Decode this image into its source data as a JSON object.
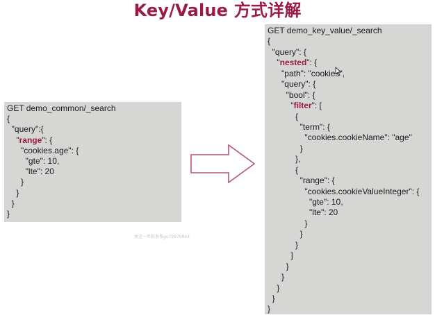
{
  "title": "Key/Value 方式详解",
  "watermark": "关注一年前发布go79979844",
  "left_code": [
    [
      "GET demo_common/_search"
    ],
    [
      "{"
    ],
    [
      "  \"query\":{"
    ],
    [
      "    \"",
      {
        "hl": "range"
      },
      "\": {"
    ],
    [
      "      \"cookies.age\": {"
    ],
    [
      "        \"gte\": 10,"
    ],
    [
      "        \"lte\": 20"
    ],
    [
      "      }"
    ],
    [
      "    }"
    ],
    [
      "  }"
    ],
    [
      "}"
    ]
  ],
  "right_code": [
    [
      "GET demo_key_value/_search"
    ],
    [
      "{"
    ],
    [
      "  \"query\": {"
    ],
    [
      "    \"",
      {
        "hl": "nested"
      },
      "\": {"
    ],
    [
      "      \"path\": \"cookies\","
    ],
    [
      "      \"query\": {"
    ],
    [
      "        \"bool\": {"
    ],
    [
      "          \"",
      {
        "hl": "filter"
      },
      "\": ["
    ],
    [
      "            {"
    ],
    [
      "              \"term\": {"
    ],
    [
      "                \"cookies.cookieName\": \"age\""
    ],
    [
      "              }"
    ],
    [
      "            },"
    ],
    [
      "            {"
    ],
    [
      "              \"range\": {"
    ],
    [
      "                \"cookies.cookieValueInteger\": {"
    ],
    [
      "                  \"gte\": 10,"
    ],
    [
      "                  \"lte\": 20"
    ],
    [
      "                }"
    ],
    [
      "              }"
    ],
    [
      "            }"
    ],
    [
      "          ]"
    ],
    [
      "        }"
    ],
    [
      "      }"
    ],
    [
      "    }"
    ],
    [
      "  }"
    ],
    [
      "}"
    ]
  ],
  "colors": {
    "title": "#9a1b43",
    "highlight": "#9a1b43",
    "panel_bg": "#d6d6d4",
    "arrow_stroke": "#b8566e"
  },
  "icons": {
    "arrow": "right-arrow-icon",
    "cursor": "mouse-pointer-icon"
  }
}
